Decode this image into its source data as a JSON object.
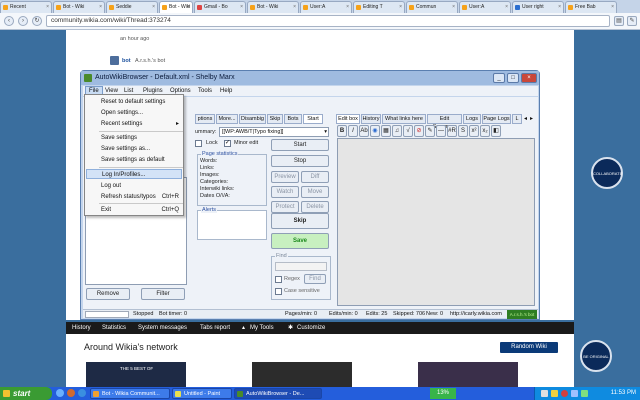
{
  "browser": {
    "tabs": [
      "Recent",
      "Bot - Wiki",
      "Seddie",
      "Bot - Wiki",
      "Gmail - Bo",
      "Bot - Wiki",
      "User:A",
      "Editing T",
      "Commun",
      "User:A",
      "User right",
      "Free Bab"
    ],
    "url": "community.wikia.com/wiki/Thread:373274"
  },
  "page": {
    "timestamp": "an hour ago",
    "bot_label": "bot",
    "bot_text": "A.r.s.h.'s bot",
    "wikia_bar": [
      "History",
      "Statistics",
      "System messages",
      "Tabs report",
      "My Tools",
      "Customize"
    ],
    "network_title": "Around Wikia's network",
    "random_wiki": "Random Wiki",
    "badge_top": "COLLABORATE",
    "badge_bottom": "BE ORIGINAL",
    "thumb_text": "THE 5 BEST OF"
  },
  "awb": {
    "title": "AutoWikiBrowser - Default.xml - Shelby Marx",
    "menu": [
      "File",
      "View",
      "List",
      "Plugins",
      "Options",
      "Tools",
      "Help"
    ],
    "file_menu": [
      {
        "label": "Reset to default settings",
        "shortcut": ""
      },
      {
        "label": "Open settings...",
        "shortcut": ""
      },
      {
        "label": "Recent settings",
        "shortcut": "▸"
      },
      {
        "label": "Save settings",
        "shortcut": ""
      },
      {
        "label": "Save settings as...",
        "shortcut": ""
      },
      {
        "label": "Save settings as default",
        "shortcut": ""
      },
      {
        "label": "Log In/Profiles...",
        "shortcut": ""
      },
      {
        "label": "Log out",
        "shortcut": ""
      },
      {
        "label": "Refresh status/typos",
        "shortcut": "Ctrl+R"
      },
      {
        "label": "Exit",
        "shortcut": "Ctrl+Q"
      }
    ],
    "mid_tabs": [
      "ptions",
      "More...",
      "Disambig",
      "Skip",
      "Bots",
      "Start"
    ],
    "right_tabs": [
      "Edit box",
      "History",
      "What links here",
      "Edit Summary",
      "Logs",
      "Page Logs",
      "L"
    ],
    "summary_label": "ummary:",
    "summary_value": "[[WP:AWB/T|Typo fixing]]",
    "lock_label": "Lock",
    "minor_label": "Minor edit",
    "page_stats_title": "Page statistics",
    "page_stats": [
      "Words:",
      "Links:",
      "Images:",
      "Categories:",
      "Interwiki links:",
      "Dates O/\\/A:"
    ],
    "alerts_title": "Alerts",
    "find_title": "Find",
    "regex_label": "Regex",
    "find_btn": "Find",
    "case_label": "Case sensitive",
    "btn_start": "Start",
    "btn_stop": "Stop",
    "btn_preview": "Preview",
    "btn_diff": "Diff",
    "btn_watch": "Watch",
    "btn_move": "Move",
    "btn_protect": "Protect",
    "btn_delete": "Delete",
    "btn_skip": "Skip",
    "btn_save": "Save",
    "btn_remove": "Remove",
    "btn_filter": "Filter",
    "status": {
      "stopped": "Stopped",
      "bot_timer": "Bot timer: 0",
      "pages_min": "Pages/min: 0",
      "edits_min": "Edits/min: 0",
      "edits": "Edits: 25",
      "skipped": "Skipped: 706",
      "new": "New: 0",
      "site": "http://icarly.wikia.com",
      "user": "A.r.s.h.'s bot"
    }
  },
  "taskbar": {
    "start": "start",
    "items": [
      "Bot - Wikia Communit...",
      "Untitled - Paint",
      "AutoWikiBrowser - De..."
    ],
    "battery": "13%",
    "clock": "11:53 PM"
  },
  "colors": {
    "wikia_bg": "#3a6e9e",
    "awb_frame": "#c4d5ec",
    "save_button": "#c8f0c0",
    "taskbar": "#245edc",
    "start_button": "#3a9b33"
  }
}
